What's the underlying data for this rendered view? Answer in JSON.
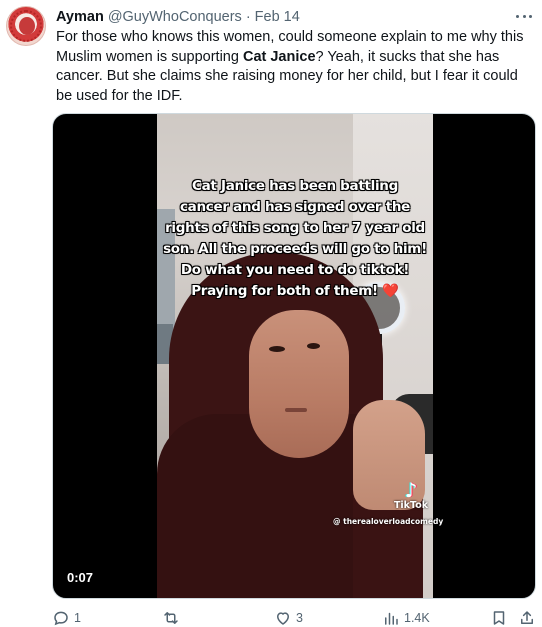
{
  "tweet": {
    "display_name": "Ayman",
    "handle": "@GuyWhoConquers",
    "separator": "·",
    "date": "Feb 14",
    "text_part1": "For those who knows this women, could someone explain to me why this Muslim women is supporting ",
    "text_bold": "Cat Janice",
    "text_part2": "? Yeah, it sucks that she has cancer. But she claims she raising money for her child, but I fear it could be used for the IDF."
  },
  "media": {
    "caption_lines": [
      "Cat Janice has been battling",
      "cancer and has signed over the",
      "rights of this song to her 7 year old",
      "son. All the proceeds will go to him!",
      "Do what you need to do tiktok!",
      "Praying for both of them!"
    ],
    "caption_emoji": "❤️",
    "watermark_brand": "TikTok",
    "watermark_user": "@ therealoverloadcomedy",
    "duration": "0:07"
  },
  "actions": {
    "replies": "1",
    "reposts": "",
    "likes": "3",
    "views": "1.4K"
  },
  "icons": {
    "more": "more-horizontal-icon",
    "reply": "reply-icon",
    "repost": "repost-icon",
    "like": "heart-icon",
    "views": "views-chart-icon",
    "bookmark": "bookmark-icon",
    "share": "share-icon"
  },
  "colors": {
    "text": "#0f1419",
    "secondary": "#536471",
    "heart_emoji": "#ff2d3a"
  }
}
